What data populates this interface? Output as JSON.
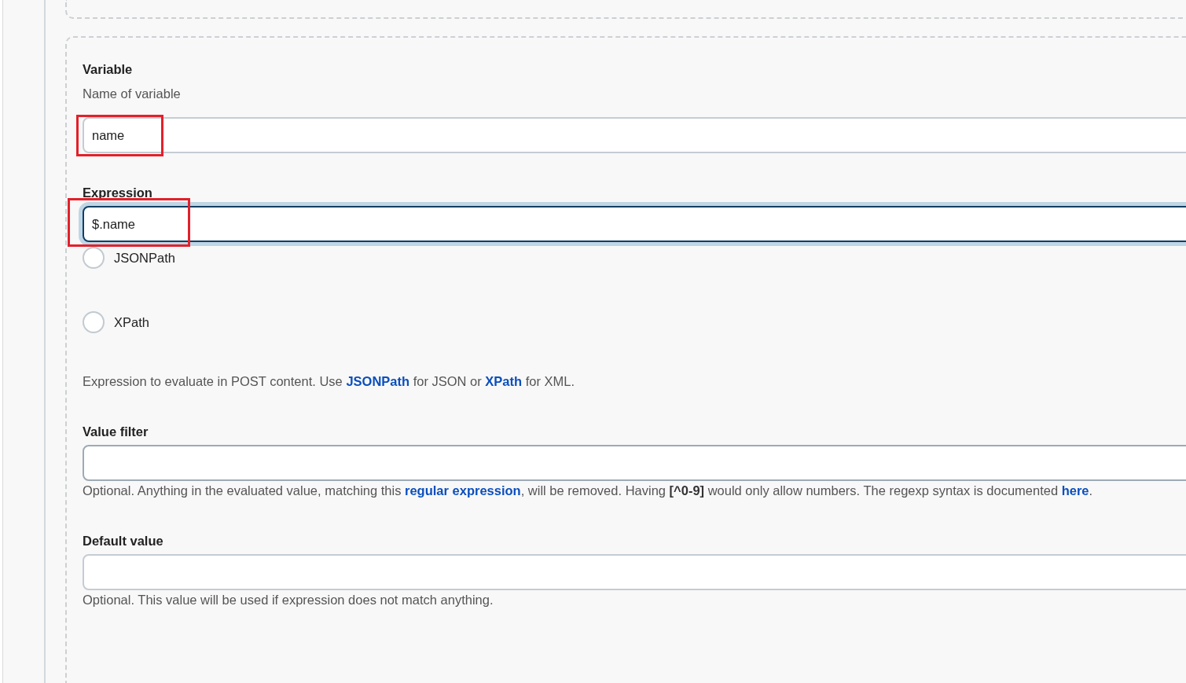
{
  "variable": {
    "title": "Variable",
    "description": "Name of variable",
    "value": "name",
    "highlighted": true
  },
  "expression": {
    "title": "Expression",
    "value": "$.name",
    "focused": true,
    "highlighted": true,
    "options": [
      {
        "label": "JSONPath",
        "selected": false
      },
      {
        "label": "XPath",
        "selected": false
      }
    ],
    "help": [
      {
        "kind": "text",
        "text": "Expression to evaluate in POST content. Use "
      },
      {
        "kind": "link",
        "text": "JSONPath"
      },
      {
        "kind": "text",
        "text": " for JSON or "
      },
      {
        "kind": "link",
        "text": "XPath"
      },
      {
        "kind": "text",
        "text": " for XML."
      }
    ]
  },
  "value_filter": {
    "title": "Value filter",
    "help": [
      {
        "kind": "text",
        "text": "Optional. Anything in the evaluated value, matching this "
      },
      {
        "kind": "link",
        "text": "regular expression"
      },
      {
        "kind": "text",
        "text": ", will be removed. Having **[^0-9]** would only allow numbers. The regexp syntax is documented "
      },
      {
        "kind": "link",
        "text": "here"
      },
      {
        "kind": "text",
        "text": "."
      }
    ]
  },
  "default_value": {
    "title": "Default value",
    "help": [
      {
        "kind": "text",
        "text": "Optional. This value will be used if expression does not match anything."
      }
    ]
  }
}
